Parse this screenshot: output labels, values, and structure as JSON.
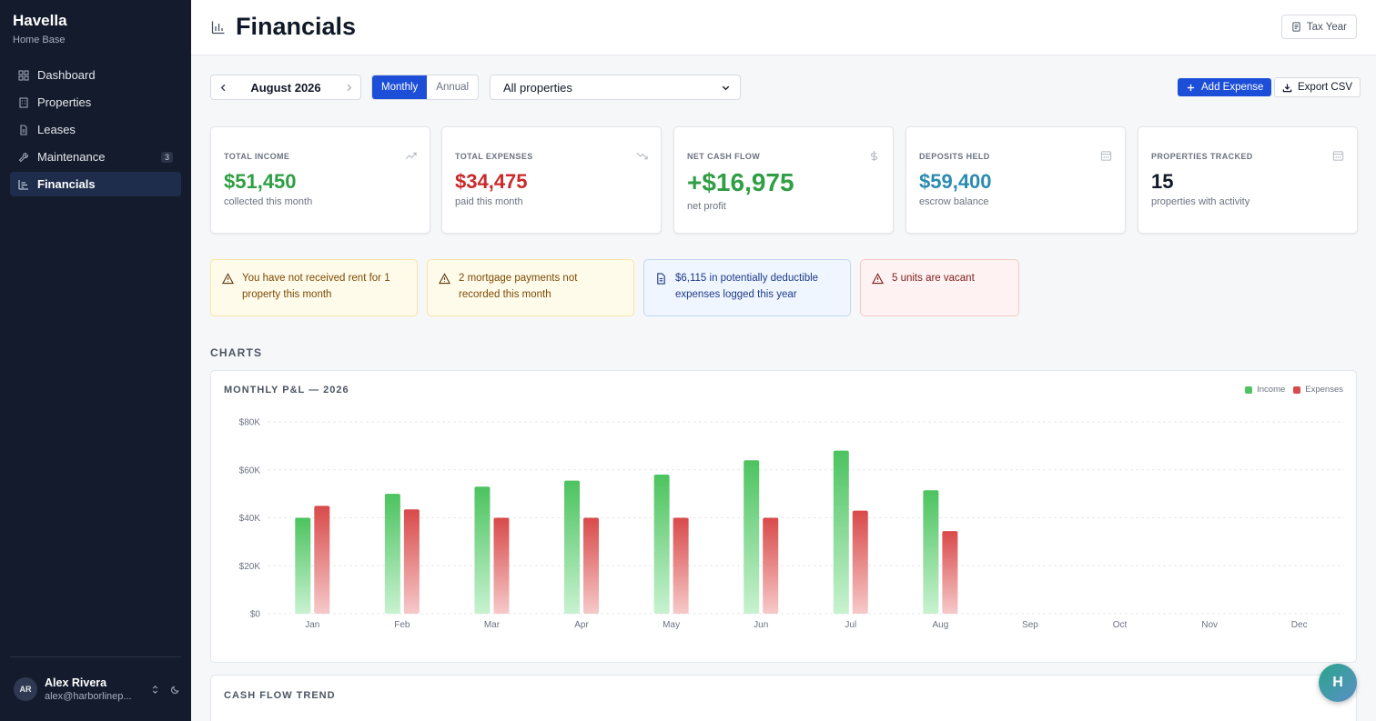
{
  "brand": {
    "name": "Havella",
    "subtitle": "Home Base"
  },
  "sidebar": {
    "items": [
      {
        "label": "Dashboard",
        "icon": "grid-icon"
      },
      {
        "label": "Properties",
        "icon": "building-icon"
      },
      {
        "label": "Leases",
        "icon": "document-icon"
      },
      {
        "label": "Maintenance",
        "icon": "wrench-icon",
        "badge": "3"
      },
      {
        "label": "Financials",
        "icon": "chart-icon",
        "active": true
      }
    ]
  },
  "user": {
    "initials": "AR",
    "name": "Alex Rivera",
    "email": "alex@harborlinep..."
  },
  "header": {
    "title": "Financials",
    "tax_year_label": "Tax Year"
  },
  "toolbar": {
    "month": "August 2026",
    "period_options": [
      "Monthly",
      "Annual"
    ],
    "period_selected": "Monthly",
    "property_filter": "All properties",
    "add_expense_label": "Add Expense",
    "export_label": "Export CSV"
  },
  "stats": [
    {
      "label": "TOTAL INCOME",
      "value": "$51,450",
      "sub": "collected this month",
      "color": "#2f9e44",
      "icon": "trend-up-icon"
    },
    {
      "label": "TOTAL EXPENSES",
      "value": "$34,475",
      "sub": "paid this month",
      "color": "#c92a2a",
      "icon": "trend-down-icon"
    },
    {
      "label": "NET CASH FLOW",
      "value": "+$16,975",
      "sub": "net profit",
      "color": "#2f9e44",
      "icon": "dollar-icon"
    },
    {
      "label": "DEPOSITS HELD",
      "value": "$59,400",
      "sub": "escrow balance",
      "color": "#2b8bb0",
      "icon": "building-icon"
    },
    {
      "label": "PROPERTIES TRACKED",
      "value": "15",
      "sub": "properties with activity",
      "color": "#111827",
      "icon": "building-icon"
    }
  ],
  "alerts": [
    {
      "text": "You have not received rent for 1 property this month",
      "type": "warning",
      "icon": "warning-icon"
    },
    {
      "text": "2 mortgage payments not recorded this month",
      "type": "warning",
      "icon": "warning-icon"
    },
    {
      "text": "$6,115 in potentially deductible expenses logged this year",
      "type": "info",
      "icon": "document-icon"
    },
    {
      "text": "5 units are vacant",
      "type": "danger",
      "icon": "warning-icon"
    }
  ],
  "sections": {
    "charts": "CHARTS",
    "cash_flow_title": "CASH FLOW TREND"
  },
  "colors": {
    "income": "#4cc35f",
    "expenses": "#d94a4a",
    "accent": "#1d4ed8",
    "sidebar": "#141b2d"
  },
  "chart_data": {
    "type": "bar",
    "title": "MONTHLY P&L — 2026",
    "categories": [
      "Jan",
      "Feb",
      "Mar",
      "Apr",
      "May",
      "Jun",
      "Jul",
      "Aug",
      "Sep",
      "Oct",
      "Nov",
      "Dec"
    ],
    "series": [
      {
        "name": "Income",
        "values": [
          40000,
          50000,
          53000,
          55500,
          58000,
          64000,
          68000,
          51450,
          null,
          null,
          null,
          null
        ]
      },
      {
        "name": "Expenses",
        "values": [
          45000,
          43500,
          40000,
          40000,
          40000,
          40000,
          43000,
          34475,
          null,
          null,
          null,
          null
        ]
      }
    ],
    "yticks": [
      "$0",
      "$20K",
      "$40K",
      "$60K",
      "$80K"
    ],
    "ylim": [
      0,
      80000
    ],
    "grid": true,
    "legend": "top-right"
  },
  "fab_label": "H"
}
